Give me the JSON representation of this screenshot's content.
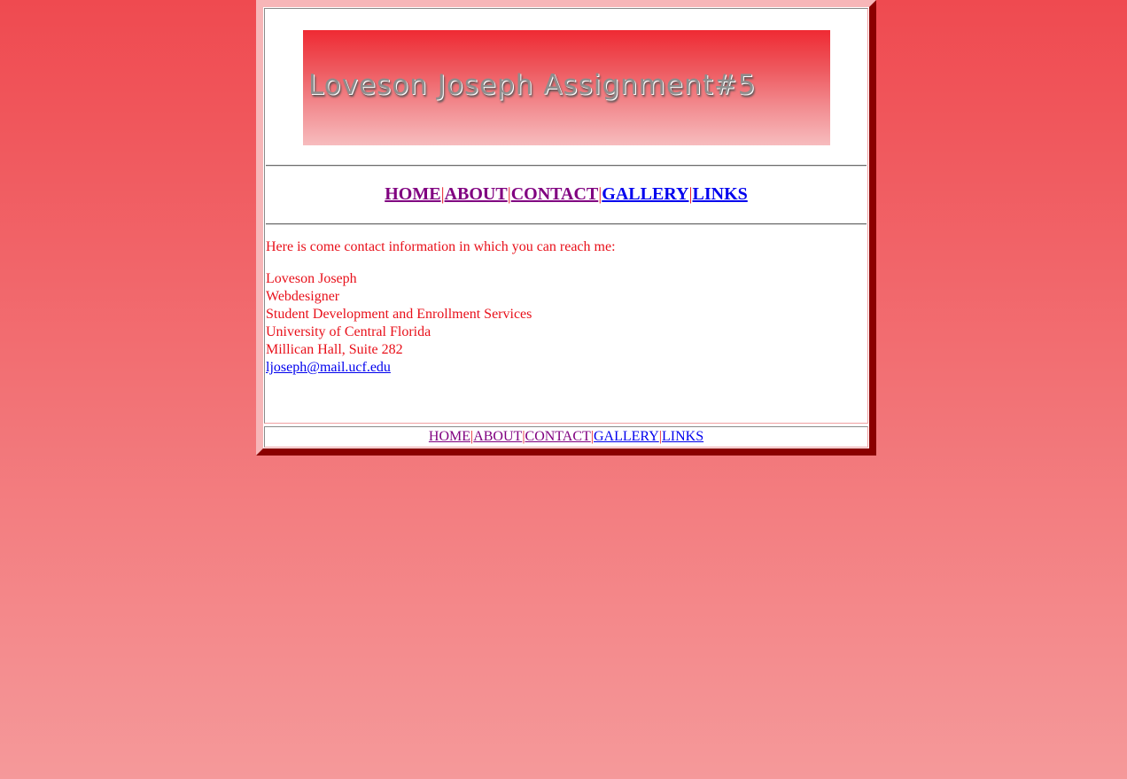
{
  "banner": {
    "text": "Loveson Joseph Assignment#5"
  },
  "nav": {
    "items": [
      {
        "label": "HOME",
        "state": "visited"
      },
      {
        "label": "ABOUT",
        "state": "visited"
      },
      {
        "label": "CONTACT",
        "state": "visited"
      },
      {
        "label": "GALLERY",
        "state": "unvisited"
      },
      {
        "label": "LINKS",
        "state": "unvisited"
      }
    ],
    "separator": "|"
  },
  "content": {
    "intro": "Here is come contact information in which you can reach me:",
    "name": "Loveson Joseph",
    "title": "Webdesigner",
    "department": "Student Development and Enrollment Services",
    "university": "University of Central Florida",
    "address": "Millican Hall, Suite 282",
    "email": "ljoseph@mail.ucf.edu"
  },
  "colors": {
    "background_top": "#ef4a50",
    "background_bottom": "#f5999a",
    "text_red": "#e8101a",
    "link_visited": "#800080",
    "link_unvisited": "#0000ee",
    "border_dark": "#8b0000",
    "border_light": "#f7b6b8"
  }
}
